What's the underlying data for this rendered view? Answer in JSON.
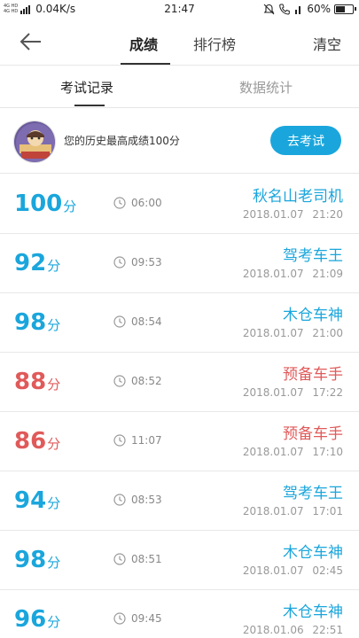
{
  "status_bar": {
    "network_top": "4G HD",
    "network_bottom": "4G HD",
    "speed": "0.04K/s",
    "time": "21:47",
    "battery": "60%",
    "battery_level": 0.6
  },
  "nav": {
    "tab_score": "成绩",
    "tab_rank": "排行榜",
    "clear": "清空"
  },
  "subtabs": {
    "records": "考试记录",
    "stats": "数据统计"
  },
  "best": {
    "text": "您的历史最高成绩100分",
    "button": "去考试"
  },
  "colors": {
    "accent": "#1aa6dc",
    "fail": "#e05a5a"
  },
  "records": [
    {
      "score": "100",
      "unit": "分",
      "duration": "06:00",
      "title": "秋名山老司机",
      "datetime": "2018.01.07 21:20",
      "color": "blue"
    },
    {
      "score": "92",
      "unit": "分",
      "duration": "09:53",
      "title": "驾考车王",
      "datetime": "2018.01.07 21:09",
      "color": "blue"
    },
    {
      "score": "98",
      "unit": "分",
      "duration": "08:54",
      "title": "木仓车神",
      "datetime": "2018.01.07 21:00",
      "color": "blue"
    },
    {
      "score": "88",
      "unit": "分",
      "duration": "08:52",
      "title": "预备车手",
      "datetime": "2018.01.07 17:22",
      "color": "red"
    },
    {
      "score": "86",
      "unit": "分",
      "duration": "11:07",
      "title": "预备车手",
      "datetime": "2018.01.07 17:10",
      "color": "red"
    },
    {
      "score": "94",
      "unit": "分",
      "duration": "08:53",
      "title": "驾考车王",
      "datetime": "2018.01.07 17:01",
      "color": "blue"
    },
    {
      "score": "98",
      "unit": "分",
      "duration": "08:51",
      "title": "木仓车神",
      "datetime": "2018.01.07 02:45",
      "color": "blue"
    },
    {
      "score": "96",
      "unit": "分",
      "duration": "09:45",
      "title": "木仓车神",
      "datetime": "2018.01.06 22:51",
      "color": "blue"
    }
  ]
}
